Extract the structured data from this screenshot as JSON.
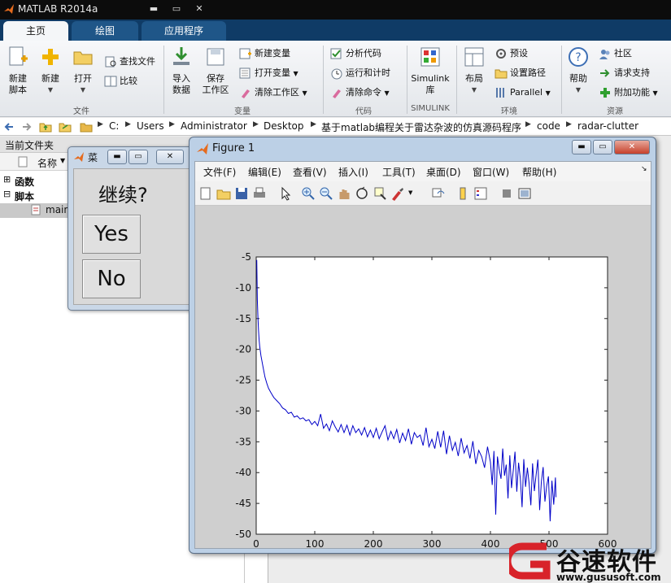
{
  "app": {
    "title": "MATLAB R2014a"
  },
  "tabs": [
    {
      "label": "主页",
      "active": true
    },
    {
      "label": "绘图",
      "active": false
    },
    {
      "label": "应用程序",
      "active": false
    }
  ],
  "ribbon": {
    "new_script": [
      "新建",
      "脚本"
    ],
    "new": "新建",
    "open": "打开",
    "find_files": "查找文件",
    "compare": "比较",
    "import_data": [
      "导入",
      "数据"
    ],
    "save_workspace": [
      "保存",
      "工作区"
    ],
    "new_variable": "新建变量",
    "open_variable": "打开变量",
    "clear_workspace": "清除工作区",
    "analyze_code": "分析代码",
    "run_and_time": "运行和计时",
    "clear_commands": "清除命令",
    "simulink_library": [
      "Simulink",
      "库"
    ],
    "layout": "布局",
    "preferences": "预设",
    "set_path": "设置路径",
    "parallel": "Parallel",
    "help": "帮助",
    "community": "社区",
    "request_support": "请求支持",
    "add_ons": "附加功能",
    "groups": {
      "file": "文件",
      "variable": "变量",
      "code": "代码",
      "simulink": "SIMULINK",
      "environment": "环境",
      "resources": "资源"
    }
  },
  "address": {
    "segments": [
      "C:",
      "Users",
      "Administrator",
      "Desktop",
      "基于matlab编程关于雷达杂波的仿真源码程序",
      "code",
      "radar-clutter"
    ]
  },
  "left_panel": {
    "title": "当前文件夹",
    "column_name": "名称",
    "items": [
      {
        "label": "函数",
        "expander": "⊞"
      },
      {
        "label": "脚本",
        "expander": "⊟"
      },
      {
        "label": "main"
      }
    ]
  },
  "dialog": {
    "title": "菜",
    "prompt": "继续?",
    "yes_label": "Yes",
    "no_label": "No"
  },
  "figure": {
    "title": "Figure 1",
    "menu": [
      "文件(F)",
      "编辑(E)",
      "查看(V)",
      "插入(I)",
      "工具(T)",
      "桌面(D)",
      "窗口(W)",
      "帮助(H)"
    ]
  },
  "colors": {
    "line": "#0000c8",
    "tab_bar": "#0f3b66",
    "title_bar": "#0c0c0c"
  },
  "chart_data": {
    "type": "line",
    "xlim": [
      0,
      600
    ],
    "ylim": [
      -50,
      -5
    ],
    "xticks": [
      0,
      100,
      200,
      300,
      400,
      500,
      600
    ],
    "yticks": [
      -5,
      -10,
      -15,
      -20,
      -25,
      -30,
      -35,
      -40,
      -45,
      -50
    ],
    "series": [
      {
        "x": [
          1,
          2,
          3,
          4,
          5,
          6,
          8,
          10,
          12,
          15,
          18,
          21,
          25,
          30,
          35,
          40,
          45,
          50,
          55,
          60,
          65,
          70,
          75,
          80,
          85,
          90,
          95,
          100,
          105,
          110,
          115,
          120,
          125,
          130,
          135,
          140,
          145,
          150,
          155,
          160,
          165,
          170,
          175,
          180,
          185,
          190,
          195,
          200,
          205,
          210,
          215,
          220,
          225,
          230,
          235,
          240,
          245,
          250,
          255,
          260,
          265,
          270,
          275,
          280,
          285,
          290,
          295,
          300,
          305,
          310,
          315,
          320,
          325,
          330,
          335,
          340,
          345,
          350,
          355,
          360,
          365,
          370,
          375,
          380,
          385,
          390,
          395,
          400,
          403,
          406,
          409,
          412,
          415,
          418,
          421,
          424,
          427,
          430,
          433,
          436,
          439,
          442,
          445,
          448,
          451,
          454,
          457,
          460,
          463,
          466,
          469,
          472,
          475,
          478,
          481,
          484,
          487,
          490,
          493,
          496,
          499,
          502,
          505,
          508,
          511,
          512
        ],
        "values": [
          -5.5,
          -12,
          -15,
          -17,
          -18.5,
          -19.5,
          -21,
          -22,
          -23,
          -24.5,
          -25.5,
          -26.3,
          -27,
          -27.8,
          -28.3,
          -28.8,
          -29.5,
          -29.8,
          -30.4,
          -30.2,
          -31,
          -30.8,
          -31.3,
          -31.1,
          -31.6,
          -31.4,
          -32.2,
          -31.7,
          -32.4,
          -30.5,
          -32.8,
          -32.1,
          -33.2,
          -31.6,
          -32.6,
          -33.4,
          -32.2,
          -33.5,
          -32.3,
          -33.9,
          -32.4,
          -33.5,
          -32.9,
          -33.9,
          -32.7,
          -34.2,
          -33.1,
          -34.3,
          -32.8,
          -34.5,
          -33.4,
          -32.4,
          -34.7,
          -33.3,
          -34.5,
          -33.0,
          -35.2,
          -33.6,
          -34.8,
          -32.9,
          -35.4,
          -33.5,
          -34.3,
          -33.9,
          -35.6,
          -32.7,
          -35.8,
          -34.6,
          -36.1,
          -33.3,
          -35.9,
          -33.2,
          -37.0,
          -34.0,
          -36.4,
          -35.1,
          -37.3,
          -34.4,
          -36.8,
          -35.6,
          -37.7,
          -34.9,
          -38.6,
          -36.4,
          -37.4,
          -39.2,
          -35.8,
          -38.3,
          -42.0,
          -36.5,
          -46.8,
          -37.4,
          -39.5,
          -41.0,
          -36.1,
          -40.5,
          -38.7,
          -44.2,
          -37.2,
          -42.5,
          -39.6,
          -36.6,
          -43.1,
          -38.4,
          -40.9,
          -45.6,
          -37.8,
          -42.3,
          -39.2,
          -41.7,
          -45.3,
          -38.5,
          -43.0,
          -40.3,
          -37.9,
          -46.1,
          -41.5,
          -39.1,
          -44.7,
          -42.2,
          -40.6,
          -47.9,
          -41.3,
          -45.2,
          -40.8,
          -44.0
        ]
      }
    ]
  },
  "watermark": {
    "text": "谷速软件",
    "url": "www.gususoft.com"
  }
}
